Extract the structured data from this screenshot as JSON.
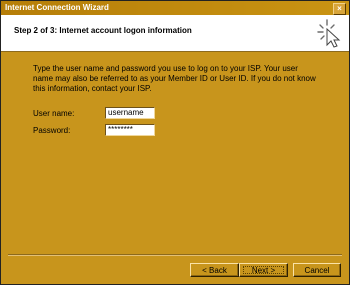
{
  "window": {
    "title": "Internet Connection Wizard",
    "close_label": "×"
  },
  "header": {
    "step_title": "Step 2 of 3: Internet account logon information",
    "icon": "wizard-pointer-icon"
  },
  "content": {
    "intro": "Type the user name and password you use to log on to your ISP. Your user name may also be referred to as your Member ID or User ID. If you do not know this information, contact your ISP.",
    "username_label": "User name:",
    "username_value": "username",
    "password_label": "Password:",
    "password_value": "********"
  },
  "buttons": {
    "back": "< Back",
    "next": "Next >",
    "cancel": "Cancel"
  },
  "colors": {
    "dialog_bg": "#c8951c",
    "header_bg": "#ffffff",
    "title_text": "#ffffff"
  }
}
